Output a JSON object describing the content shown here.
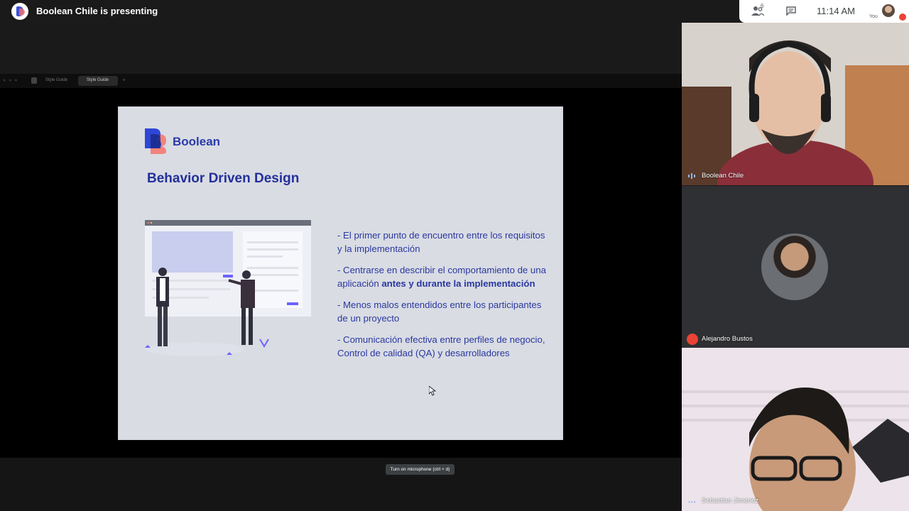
{
  "header": {
    "presenting_text": "Boolean Chile is presenting"
  },
  "right_panel": {
    "people_count": "6",
    "time": "11:14 AM",
    "you_label": "You"
  },
  "share_strip": {
    "tab1_label": "Style Guide",
    "tab2_label": "Style Guide"
  },
  "slide": {
    "brand_name": "Boolean",
    "title": "Behavior Driven Design",
    "bullets": [
      {
        "text": "- El primer punto de encuentro entre los requisitos y la implementación"
      },
      {
        "text_before": "- Centrarse en describir el comportamiento de una aplicación ",
        "text_bold": "antes y durante la implementación"
      },
      {
        "text": "- Menos malos entendidos entre los participantes de un proyecto"
      },
      {
        "text": "- Comunicación efectiva entre perfiles de negocio, Control de calidad (QA) y desarrolladores"
      }
    ],
    "colors": {
      "brand_blue": "#2a3aa8",
      "brand_pink": "#f07070",
      "slide_bg": "#d9dce3"
    }
  },
  "tooltip": {
    "text": "Turn on microphone (ctrl + d)"
  },
  "participants": [
    {
      "name": "Boolean Chile",
      "state": "speaking"
    },
    {
      "name": "Alejandro Bustos",
      "state": "muted"
    },
    {
      "name": "Sebastian Jimenez",
      "state": "active"
    }
  ]
}
